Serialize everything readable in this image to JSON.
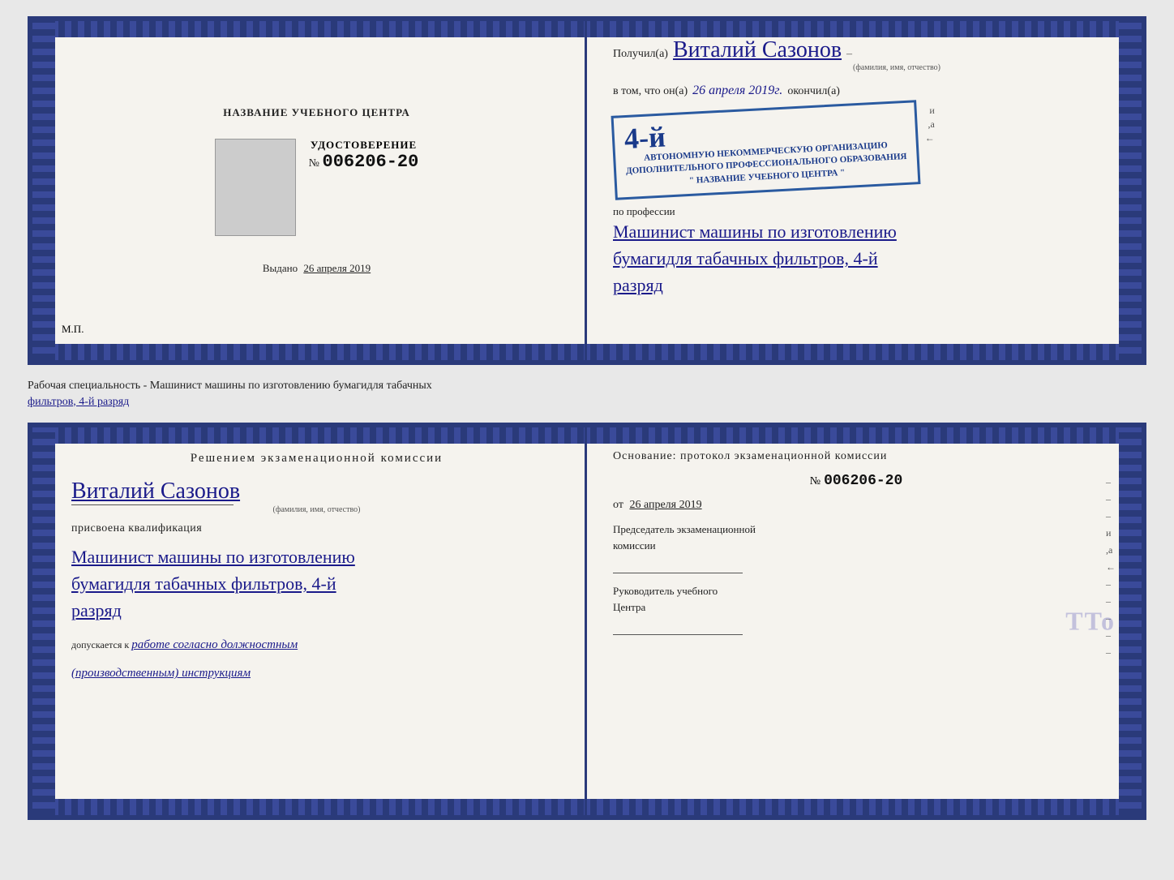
{
  "top_cert": {
    "left": {
      "title": "НАЗВАНИЕ УЧЕБНОГО ЦЕНТРА",
      "udostoverenie_label": "УДОСТОВЕРЕНИЕ",
      "number_sign": "№",
      "number_value": "006206-20",
      "vydano_label": "Выдано",
      "vydano_date": "26 апреля 2019",
      "mp_label": "М.П."
    },
    "right": {
      "poluchil_prefix": "Получил(а)",
      "name_handwritten": "Виталий Сазонов",
      "name_subtitle": "(фамилия, имя, отчество)",
      "dash": "–",
      "vtom_prefix": "в том, что он(а)",
      "date_handwritten": "26 апреля 2019г.",
      "okончил_label": "окончил(а)",
      "stamp_num": "4-й",
      "stamp_line1": "АВТОНОМНУЮ НЕКОММЕРЧЕСКУЮ ОРГАНИЗАЦИЮ",
      "stamp_line2": "ДОПОЛНИТЕЛЬНОГО ПРОФЕССИОНАЛЬНОГО ОБРАЗОВАНИЯ",
      "stamp_line3": "\" НАЗВАНИЕ УЧЕБНОГО ЦЕНТРА \"",
      "i_mark": "и",
      "a_mark": ",а",
      "arrow_mark": "←",
      "po_professii": "по профессии",
      "profession_line1": "Машинист машины по изготовлению",
      "profession_line2": "бумагидля табачных фильтров, 4-й",
      "profession_line3": "разряд"
    }
  },
  "between": {
    "text_normal": "Рабочая специальность - Машинист машины по изготовлению бумагидля табачных",
    "text_underline": "фильтров, 4-й разряд"
  },
  "bottom_cert": {
    "left": {
      "resolution_title": "Решением  экзаменационной  комиссии",
      "name_handwritten": "Виталий Сазонов",
      "name_subtitle": "(фамилия, имя, отчество)",
      "prisvoena": "присвоена квалификация",
      "profession_line1": "Машинист машины по изготовлению",
      "profession_line2": "бумагидля табачных фильтров, 4-й",
      "profession_line3": "разряд",
      "dopusk_prefix": "допускается к",
      "dopusk_handwritten": "работе согласно должностным",
      "dopusk_handwritten2": "(производственным) инструкциям"
    },
    "right": {
      "osnov_label": "Основание: протокол экзаменационной  комиссии",
      "number_sign": "№",
      "number_value": "006206-20",
      "ot_prefix": "от",
      "ot_date": "26 апреля 2019",
      "chair_label": "Председатель экзаменационной",
      "chair_label2": "комиссии",
      "ruk_label": "Руководитель учебного",
      "ruk_label2": "Центра",
      "i_mark": "и",
      "a_mark": ",а",
      "arrow_mark": "←",
      "tto": "TTo"
    }
  }
}
